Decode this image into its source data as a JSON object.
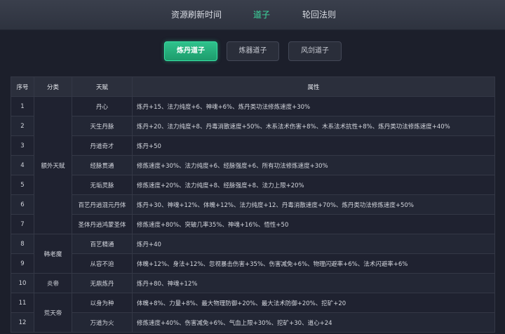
{
  "nav": {
    "tabs": [
      {
        "label": "资源刷新时间"
      },
      {
        "label": "道子"
      },
      {
        "label": "轮回法则"
      }
    ]
  },
  "subtabs": [
    {
      "label": "炼丹道子"
    },
    {
      "label": "炼器道子"
    },
    {
      "label": "风剑道子"
    }
  ],
  "table": {
    "headers": [
      "序号",
      "分类",
      "天赋",
      "属性"
    ],
    "groups": [
      {
        "category": "额外天赋",
        "rows": [
          {
            "no": "1",
            "talent": "丹心",
            "attr": "炼丹+15、法力纯度+6、神魂+6%、炼丹类功法修炼速度+30%"
          },
          {
            "no": "2",
            "talent": "天生丹脉",
            "attr": "炼丹+20、法力纯度+8、丹毒消散速度+50%、木系法术伤害+8%、木系法术抗性+8%、炼丹类功法修炼速度+40%"
          },
          {
            "no": "3",
            "talent": "丹道奇才",
            "attr": "炼丹+50"
          },
          {
            "no": "4",
            "talent": "经脉贯通",
            "attr": "修炼速度+30%、法力纯度+6、经脉强度+6、所有功法修炼速度+30%"
          },
          {
            "no": "5",
            "talent": "无垢灵脉",
            "attr": "修炼速度+20%、法力纯度+8、经脉强度+8、法力上限+20%"
          },
          {
            "no": "6",
            "talent": "百艺丹逍混元丹体",
            "attr": "炼丹+30、神魂+12%、体魄+12%、法力纯度+12、丹毒消散速度+70%、炼丹类功法修炼速度+50%"
          },
          {
            "no": "7",
            "talent": "圣体丹逍鸿蒙圣体",
            "attr": "修炼速度+80%、突破几率35%、神魂+16%、悟性+50"
          }
        ]
      },
      {
        "category": "韩老魔",
        "rows": [
          {
            "no": "8",
            "talent": "百艺精通",
            "attr": "炼丹+40"
          },
          {
            "no": "9",
            "talent": "从容不迫",
            "attr": "体魄+12%、身法+12%、忽视暴击伤害+35%、伤害减免+6%、物理闪避率+6%、法术闪避率+6%"
          }
        ]
      },
      {
        "category": "炎帝",
        "rows": [
          {
            "no": "10",
            "talent": "无鼎炼丹",
            "attr": "炼丹+80、神魂+12%"
          }
        ]
      },
      {
        "category": "荒天帝",
        "rows": [
          {
            "no": "11",
            "talent": "以身为种",
            "attr": "体魄+8%、力量+8%、最大物理防御+20%、最大法术防御+20%、挖矿+20"
          },
          {
            "no": "12",
            "talent": "万道为火",
            "attr": "修炼速度+40%、伤害减免+6%、气血上限+30%、挖矿+30、道心+24"
          }
        ]
      }
    ]
  }
}
